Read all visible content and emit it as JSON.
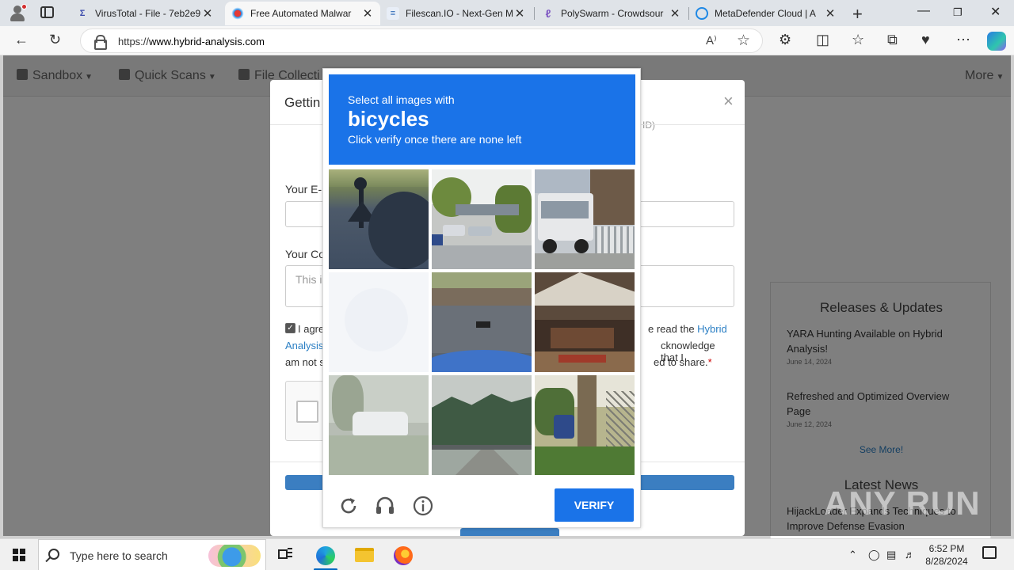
{
  "browser": {
    "tabs": [
      {
        "title": "VirusTotal - File - 7eb2e9",
        "favicon": "virustotal-icon",
        "active": false
      },
      {
        "title": "Free Automated Malwar",
        "favicon": "hybrid-analysis-icon",
        "active": true
      },
      {
        "title": "Filescan.IO - Next-Gen M",
        "favicon": "filescan-icon",
        "active": false
      },
      {
        "title": "PolySwarm - Crowdsour",
        "favicon": "polyswarm-icon",
        "active": false
      },
      {
        "title": "MetaDefender Cloud | A",
        "favicon": "metadefender-icon",
        "active": false
      }
    ],
    "url_prefix": "https://",
    "url_host": "www.hybrid-analysis.com",
    "read_aloud_glyph": "A⁾"
  },
  "site": {
    "nav": [
      {
        "label": "Sandbox"
      },
      {
        "label": "Quick Scans"
      },
      {
        "label": "File Collecti"
      }
    ],
    "nav_more": "More",
    "sidebar": {
      "releases_title": "Releases & Updates",
      "items": [
        {
          "title": "YARA Hunting Available on Hybrid Analysis!",
          "date": "June 14, 2024"
        },
        {
          "title": "Refreshed and Optimized Overview Page",
          "date": "June 12, 2024"
        }
      ],
      "see_more": "See More!",
      "latest_title": "Latest News",
      "latest_item": "HijackLoader Expands Techniques to Improve Defense Evasion"
    }
  },
  "dialog": {
    "title": "Gettin",
    "title_right_fragment": "ID)",
    "email_label": "Your E-M",
    "comment_label": "Your Co",
    "comment_placeholder": "This is",
    "agree_line1_left": "I agre",
    "agree_line1_right": "e read the",
    "agree_link_a": "Hybrid",
    "agree_link_b": "Analysis",
    "agree_line2_right": "cknowledge that I",
    "agree_line3_left": "am not s",
    "agree_line3_right": "ed to share.",
    "required_mark": "*"
  },
  "captcha": {
    "prompt_line1": "Select all images with",
    "prompt_target": "bicycles",
    "prompt_line3": "Click verify once there are none left",
    "verify_label": "VERIFY",
    "tiles": [
      {
        "id": 1,
        "scene": "shadow-of-camera-pole-on-road"
      },
      {
        "id": 2,
        "scene": "parking-lot-with-cars"
      },
      {
        "id": 3,
        "scene": "white-truck-near-building"
      },
      {
        "id": 4,
        "scene": "faded-blank-image"
      },
      {
        "id": 5,
        "scene": "road-with-blue-car-hood"
      },
      {
        "id": 6,
        "scene": "tent-canopy-with-bench"
      },
      {
        "id": 7,
        "scene": "white-car-by-trees-faded"
      },
      {
        "id": 8,
        "scene": "highway-through-forest"
      },
      {
        "id": 9,
        "scene": "tree-trunk-with-scooter"
      }
    ]
  },
  "watermark": "ANY RUN",
  "taskbar": {
    "search_placeholder": "Type here to search",
    "time": "6:52 PM",
    "date": "8/28/2024"
  },
  "colors": {
    "captcha_blue": "#1a73e8",
    "link_blue": "#2b7fc4",
    "submit_blue": "#3b7ec1"
  }
}
